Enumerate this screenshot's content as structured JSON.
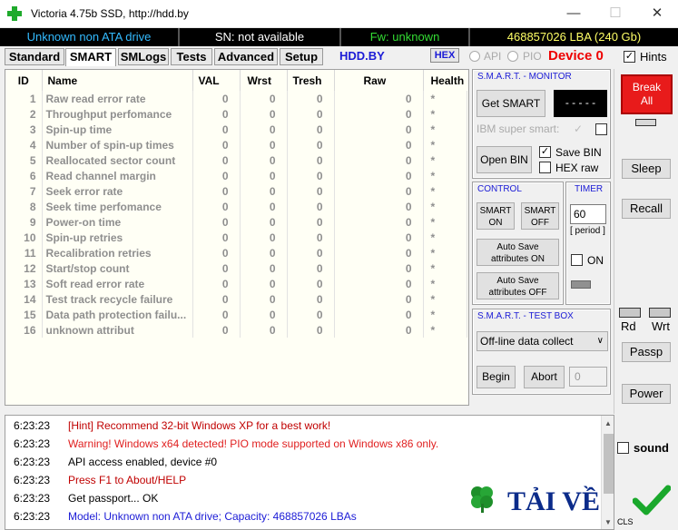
{
  "window": {
    "title": "Victoria 4.75b SSD, http://hdd.by"
  },
  "info": {
    "drive": "Unknown non ATA drive",
    "sn": "SN: not available",
    "fw": "Fw: unknown",
    "lba": "468857026 LBA (240 Gb)"
  },
  "tabs": [
    "Standard",
    "SMART",
    "SMLogs",
    "Tests",
    "Advanced",
    "Setup"
  ],
  "active_tab": "SMART",
  "toolbar": {
    "link": "HDD.BY",
    "hex": "HEX",
    "api": "API",
    "pio": "PIO",
    "device": "Device 0",
    "hints": "Hints"
  },
  "table": {
    "headers": [
      "ID",
      "Name",
      "VAL",
      "Wrst",
      "Tresh",
      "Raw",
      "Health"
    ],
    "rows": [
      {
        "id": "1",
        "name": "Raw read error rate",
        "val": "0",
        "wrst": "0",
        "tresh": "0",
        "raw": "0",
        "health": "*"
      },
      {
        "id": "2",
        "name": "Throughput perfomance",
        "val": "0",
        "wrst": "0",
        "tresh": "0",
        "raw": "0",
        "health": "*"
      },
      {
        "id": "3",
        "name": "Spin-up time",
        "val": "0",
        "wrst": "0",
        "tresh": "0",
        "raw": "0",
        "health": "*"
      },
      {
        "id": "4",
        "name": "Number of spin-up times",
        "val": "0",
        "wrst": "0",
        "tresh": "0",
        "raw": "0",
        "health": "*"
      },
      {
        "id": "5",
        "name": "Reallocated sector count",
        "val": "0",
        "wrst": "0",
        "tresh": "0",
        "raw": "0",
        "health": "*"
      },
      {
        "id": "6",
        "name": "Read channel margin",
        "val": "0",
        "wrst": "0",
        "tresh": "0",
        "raw": "0",
        "health": "*"
      },
      {
        "id": "7",
        "name": "Seek error rate",
        "val": "0",
        "wrst": "0",
        "tresh": "0",
        "raw": "0",
        "health": "*"
      },
      {
        "id": "8",
        "name": "Seek time perfomance",
        "val": "0",
        "wrst": "0",
        "tresh": "0",
        "raw": "0",
        "health": "*"
      },
      {
        "id": "9",
        "name": "Power-on time",
        "val": "0",
        "wrst": "0",
        "tresh": "0",
        "raw": "0",
        "health": "*"
      },
      {
        "id": "10",
        "name": "Spin-up retries",
        "val": "0",
        "wrst": "0",
        "tresh": "0",
        "raw": "0",
        "health": "*"
      },
      {
        "id": "11",
        "name": "Recalibration retries",
        "val": "0",
        "wrst": "0",
        "tresh": "0",
        "raw": "0",
        "health": "*"
      },
      {
        "id": "12",
        "name": "Start/stop count",
        "val": "0",
        "wrst": "0",
        "tresh": "0",
        "raw": "0",
        "health": "*"
      },
      {
        "id": "13",
        "name": "Soft read error rate",
        "val": "0",
        "wrst": "0",
        "tresh": "0",
        "raw": "0",
        "health": "*"
      },
      {
        "id": "14",
        "name": "Test track recycle failure",
        "val": "0",
        "wrst": "0",
        "tresh": "0",
        "raw": "0",
        "health": "*"
      },
      {
        "id": "15",
        "name": "Data path protection failu...",
        "val": "0",
        "wrst": "0",
        "tresh": "0",
        "raw": "0",
        "health": "*"
      },
      {
        "id": "16",
        "name": "unknown attribut",
        "val": "0",
        "wrst": "0",
        "tresh": "0",
        "raw": "0",
        "health": "*"
      }
    ]
  },
  "smart_monitor": {
    "title": "S.M.A.R.T. - MONITOR",
    "get_smart": "Get SMART",
    "display": "- - - - -",
    "ibm": "IBM super smart:",
    "open_bin": "Open BIN",
    "save_bin": "Save BIN",
    "hex_raw": "HEX raw"
  },
  "control": {
    "title": "CONTROL",
    "smart_on": "SMART ON",
    "smart_off": "SMART OFF",
    "auto_on": "Auto Save attributes ON",
    "auto_off": "Auto Save attributes OFF"
  },
  "timer": {
    "title": "TIMER",
    "value": "60",
    "period": "[ period ]",
    "on": "ON"
  },
  "testbox": {
    "title": "S.M.A.R.T. - TEST BOX",
    "select": "Off-line data collect",
    "begin": "Begin",
    "abort": "Abort",
    "field": "0"
  },
  "sidebar": {
    "break_all": "Break All",
    "sleep": "Sleep",
    "recall": "Recall",
    "rd": "Rd",
    "wrt": "Wrt",
    "passp": "Passp",
    "power": "Power",
    "sound": "sound",
    "cls": "CLS"
  },
  "log": [
    {
      "time": "6:23:23",
      "msg": "[Hint] Recommend 32-bit Windows XP for a best work!",
      "color": "#c00000"
    },
    {
      "time": "6:23:23",
      "msg": "Warning! Windows x64 detected! PIO mode supported on Windows x86 only.",
      "color": "#e02020"
    },
    {
      "time": "6:23:23",
      "msg": "API access enabled, device #0",
      "color": "#000000"
    },
    {
      "time": "6:23:23",
      "msg": "Press F1 to About/HELP",
      "color": "#c00000"
    },
    {
      "time": "6:23:23",
      "msg": "Get passport... OK",
      "color": "#000000"
    },
    {
      "time": "6:23:23",
      "msg": "Model: Unknown non ATA drive; Capacity: 468857026 LBAs",
      "color": "#1b1bd6"
    }
  ],
  "watermark": {
    "text": "TẢI VỀ"
  },
  "colors": {
    "info_drive": "#33bbff",
    "info_sn": "#ffffff",
    "info_fw": "#33dd33",
    "info_lba": "#ffff66",
    "break": "#e81b1b"
  }
}
